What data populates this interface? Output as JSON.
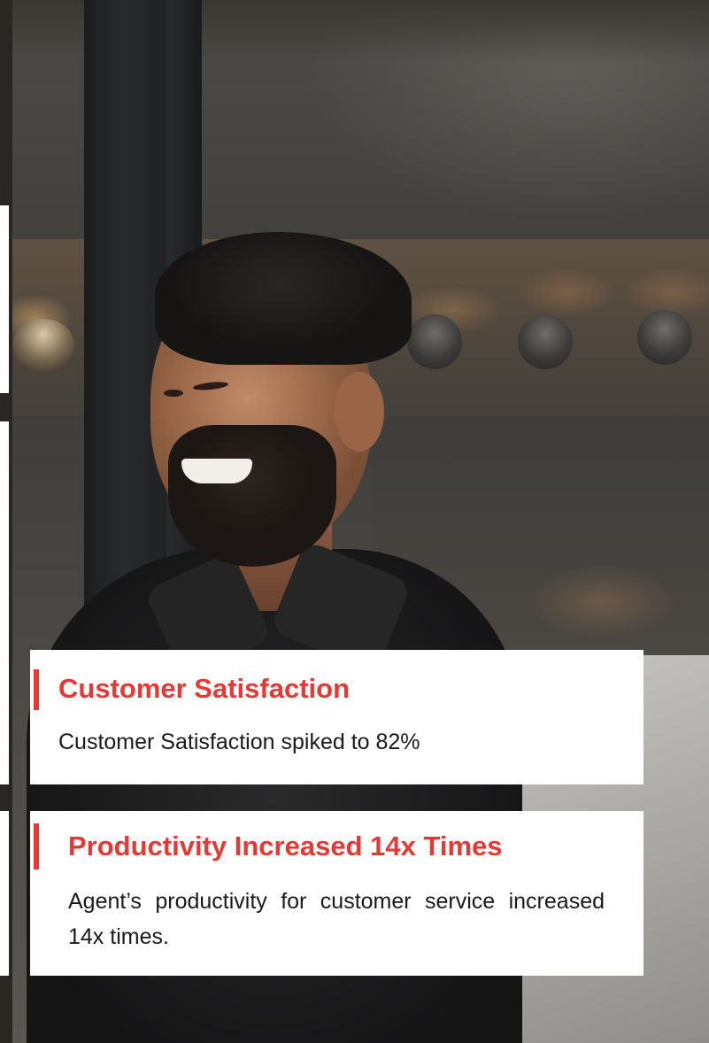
{
  "cards": [
    {
      "title": "Customer Satisfaction",
      "body": "Customer Satisfaction spiked to 82%"
    },
    {
      "title": "Productivity Increased 14x Times",
      "body": "Agent’s productivity for customer service increased 14x times."
    }
  ],
  "colors": {
    "accent": "#e53935",
    "card_background": "#ffffff",
    "body_text": "#1a1a1a"
  }
}
